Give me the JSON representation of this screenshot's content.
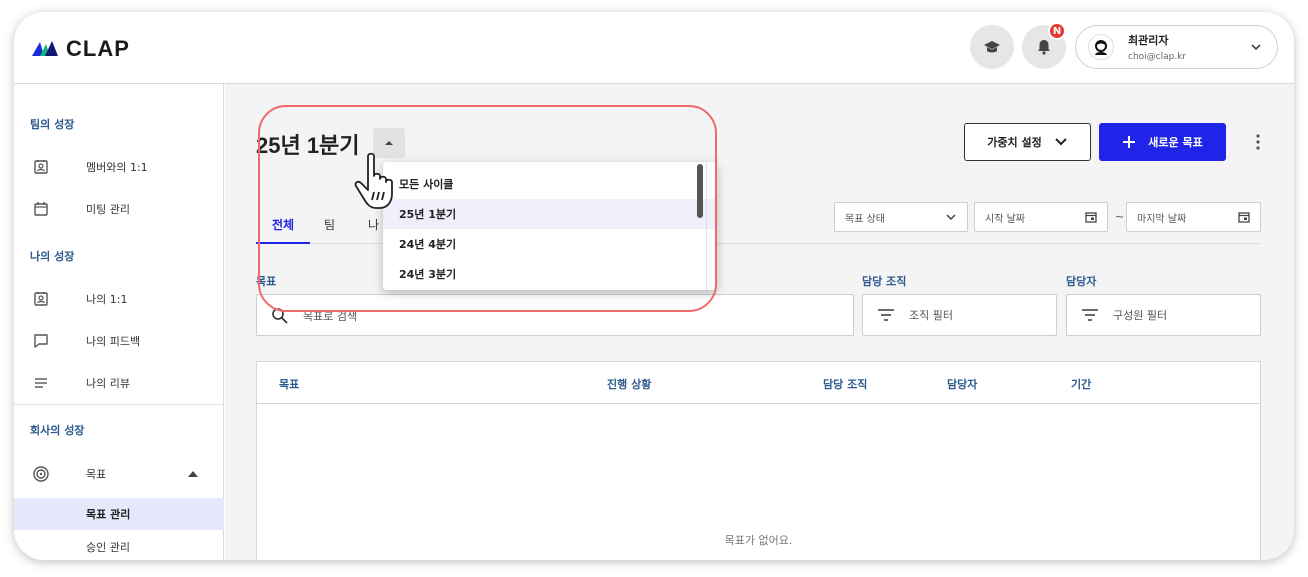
{
  "header": {
    "logo": "CLAP",
    "notification_badge": "N",
    "user": {
      "name": "최관리자",
      "email": "choi@clap.kr"
    }
  },
  "sidebar": {
    "sections": [
      {
        "title": "팀의 성장"
      },
      {
        "title": "나의 성장"
      },
      {
        "title": "회사의 성장"
      }
    ],
    "items": [
      {
        "label": "멤버와의 1:1",
        "icon": "member-1on1-icon"
      },
      {
        "label": "미팅 관리",
        "icon": "calendar-icon"
      },
      {
        "label": "나의 1:1",
        "icon": "my-1on1-icon"
      },
      {
        "label": "나의 피드백",
        "icon": "chat-icon"
      },
      {
        "label": "나의 리뷰",
        "icon": "list-icon"
      },
      {
        "label": "목표",
        "icon": "target-icon"
      },
      {
        "label": "목표 관리"
      },
      {
        "label": "승인 관리"
      }
    ]
  },
  "main": {
    "title": "25년 1분기",
    "weight_button": "가중치 설정",
    "new_goal_button": "새로운 목표",
    "tabs": [
      "전체",
      "팀",
      "나"
    ],
    "filters": {
      "status": "목표 상태",
      "start_date": "시작 날짜",
      "range_sep": "~",
      "end_date": "마지막 날짜"
    },
    "fields": {
      "goal_label": "목표",
      "search_placeholder": "목표로 검색",
      "org_label": "담당 조직",
      "org_filter": "조직 필터",
      "owner_label": "담당자",
      "member_filter": "구성원 필터"
    },
    "table": {
      "headers": [
        "목표",
        "진행 상황",
        "담당 조직",
        "담당자",
        "기간"
      ],
      "empty": "목표가 없어요."
    }
  },
  "dropdown": {
    "options": [
      "모든 사이클",
      "25년 1분기",
      "24년 4분기",
      "24년 3분기"
    ],
    "selected_index": 1
  },
  "colors": {
    "primary": "#1f24e8",
    "highlight": "#f06a6a",
    "section_title": "#2d5a8e"
  }
}
